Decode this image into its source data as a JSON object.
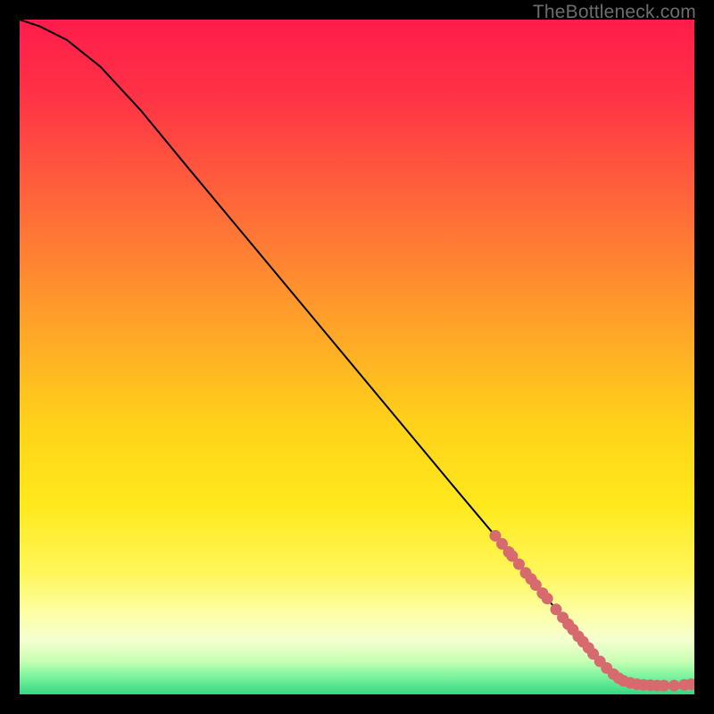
{
  "attribution": "TheBottleneck.com",
  "colors": {
    "bg": "#000000",
    "marker": "#d76a6f",
    "line": "#000000",
    "attribution": "#6d6d6d"
  },
  "chart_data": {
    "type": "line",
    "title": "",
    "xlabel": "",
    "ylabel": "",
    "xlim": [
      0,
      100
    ],
    "ylim": [
      0,
      100
    ],
    "gradient_stops": [
      {
        "pct": 0,
        "color": "#ff1c4b"
      },
      {
        "pct": 12,
        "color": "#ff3445"
      },
      {
        "pct": 28,
        "color": "#ff6a3a"
      },
      {
        "pct": 45,
        "color": "#ffa229"
      },
      {
        "pct": 60,
        "color": "#ffd21a"
      },
      {
        "pct": 72,
        "color": "#ffe91c"
      },
      {
        "pct": 82,
        "color": "#fff65a"
      },
      {
        "pct": 88,
        "color": "#fdffa6"
      },
      {
        "pct": 92,
        "color": "#f4ffd0"
      },
      {
        "pct": 95,
        "color": "#c9ffb4"
      },
      {
        "pct": 97,
        "color": "#86f6a0"
      },
      {
        "pct": 100,
        "color": "#35d884"
      }
    ],
    "curve": [
      {
        "x": 0,
        "y": 100
      },
      {
        "x": 3,
        "y": 99
      },
      {
        "x": 7,
        "y": 97
      },
      {
        "x": 12,
        "y": 93
      },
      {
        "x": 18,
        "y": 86.5
      },
      {
        "x": 25,
        "y": 78
      },
      {
        "x": 35,
        "y": 66
      },
      {
        "x": 45,
        "y": 54
      },
      {
        "x": 55,
        "y": 42
      },
      {
        "x": 65,
        "y": 30
      },
      {
        "x": 73,
        "y": 20.5
      },
      {
        "x": 80,
        "y": 12
      },
      {
        "x": 85,
        "y": 6
      },
      {
        "x": 88,
        "y": 3
      },
      {
        "x": 90,
        "y": 1.8
      },
      {
        "x": 92,
        "y": 1.4
      },
      {
        "x": 95,
        "y": 1.3
      },
      {
        "x": 98,
        "y": 1.3
      },
      {
        "x": 100,
        "y": 1.5
      }
    ],
    "markers": [
      {
        "x": 70.5,
        "y": 23.5
      },
      {
        "x": 71.5,
        "y": 22.3
      },
      {
        "x": 72.5,
        "y": 21.1
      },
      {
        "x": 73.0,
        "y": 20.5
      },
      {
        "x": 74.0,
        "y": 19.3
      },
      {
        "x": 75.0,
        "y": 18.0
      },
      {
        "x": 75.8,
        "y": 17.1
      },
      {
        "x": 76.5,
        "y": 16.2
      },
      {
        "x": 77.5,
        "y": 15.0
      },
      {
        "x": 78.2,
        "y": 14.2
      },
      {
        "x": 79.5,
        "y": 12.6
      },
      {
        "x": 80.5,
        "y": 11.4
      },
      {
        "x": 81.3,
        "y": 10.4
      },
      {
        "x": 82.0,
        "y": 9.6
      },
      {
        "x": 82.8,
        "y": 8.6
      },
      {
        "x": 83.5,
        "y": 7.8
      },
      {
        "x": 84.3,
        "y": 6.9
      },
      {
        "x": 85.0,
        "y": 6.0
      },
      {
        "x": 86.0,
        "y": 4.9
      },
      {
        "x": 87.0,
        "y": 3.9
      },
      {
        "x": 88.0,
        "y": 3.0
      },
      {
        "x": 88.8,
        "y": 2.4
      },
      {
        "x": 89.5,
        "y": 2.0
      },
      {
        "x": 90.5,
        "y": 1.7
      },
      {
        "x": 91.5,
        "y": 1.5
      },
      {
        "x": 92.5,
        "y": 1.4
      },
      {
        "x": 93.5,
        "y": 1.35
      },
      {
        "x": 94.5,
        "y": 1.3
      },
      {
        "x": 95.5,
        "y": 1.3
      },
      {
        "x": 97.0,
        "y": 1.3
      },
      {
        "x": 98.5,
        "y": 1.4
      },
      {
        "x": 99.5,
        "y": 1.5
      }
    ]
  }
}
